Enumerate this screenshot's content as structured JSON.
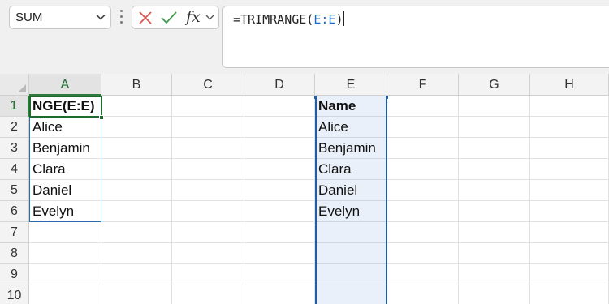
{
  "formula_bar": {
    "name_box": "SUM",
    "cancel_icon": "x-icon",
    "enter_icon": "check-icon",
    "fx_label": "fx",
    "formula_prefix": "=TRIMRANGE(",
    "formula_ref": "E:E",
    "formula_suffix": ")"
  },
  "columns": [
    "A",
    "B",
    "C",
    "D",
    "E",
    "F",
    "G",
    "H"
  ],
  "rows": [
    "1",
    "2",
    "3",
    "4",
    "5",
    "6",
    "7",
    "8",
    "9",
    "10"
  ],
  "cells": {
    "A": [
      "NGE(E:E)",
      "Alice",
      "Benjamin",
      "Clara",
      "Daniel",
      "Evelyn"
    ],
    "E": [
      "Name",
      "Alice",
      "Benjamin",
      "Clara",
      "Daniel",
      "Evelyn"
    ]
  },
  "colors": {
    "active_cell": "#1e6b2e",
    "spill_border": "#2b6cb0",
    "range_highlight": "#1f5da8",
    "formula_ref": "#1a6dc4"
  }
}
